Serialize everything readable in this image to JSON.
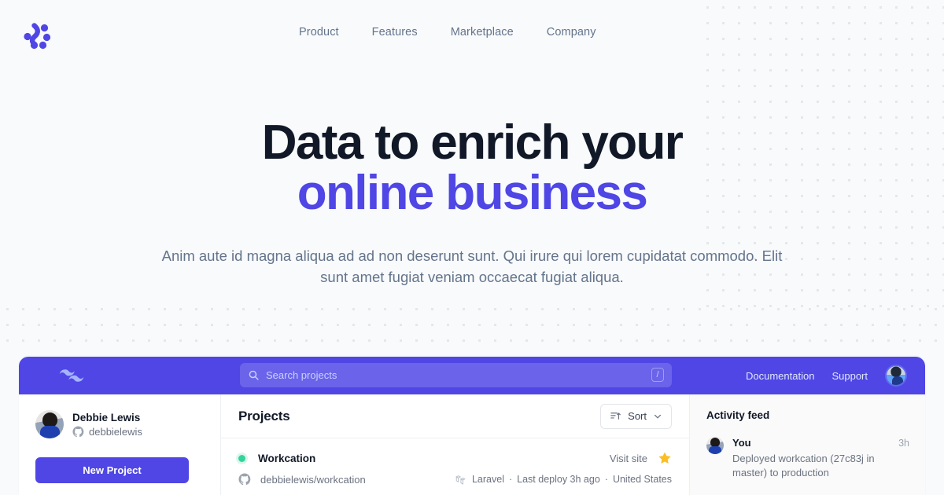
{
  "brand": {
    "logo_icon": "dots-cluster-logo",
    "accent_color": "#4f46e5",
    "page_bg": "#f8fafc"
  },
  "topnav": {
    "links": [
      {
        "label": "Product"
      },
      {
        "label": "Features"
      },
      {
        "label": "Marketplace"
      },
      {
        "label": "Company"
      }
    ]
  },
  "hero": {
    "headline_line1": "Data to enrich your",
    "headline_line2": "online business",
    "subtitle": "Anim aute id magna aliqua ad ad non deserunt sunt. Qui irure qui lorem cupidatat commodo. Elit sunt amet fugiat veniam occaecat fugiat aliqua."
  },
  "app": {
    "appbar": {
      "logo_icon": "tailwind-wave-logo",
      "search": {
        "icon": "search-icon",
        "placeholder": "Search projects",
        "value": "",
        "shortcut_key": "/"
      },
      "links": [
        {
          "label": "Documentation"
        },
        {
          "label": "Support"
        }
      ],
      "avatar_icon": "user-avatar"
    },
    "sidebar": {
      "user": {
        "name": "Debbie Lewis",
        "handle": "debbielewis",
        "handle_icon": "github-icon",
        "avatar_icon": "user-avatar"
      },
      "new_project_label": "New Project"
    },
    "projects": {
      "title": "Projects",
      "sort": {
        "label": "Sort",
        "icon": "sort-ascending-icon",
        "chevron": "chevron-down-icon"
      },
      "items": [
        {
          "status_color": "#34d399",
          "name": "Workcation",
          "visit_label": "Visit site",
          "starred": true,
          "star_color": "#fbbf24",
          "repo": "debbielewis/workcation",
          "repo_icon": "github-icon",
          "framework_icon": "laravel-icon",
          "framework": "Laravel",
          "separator": "·",
          "deploy": "Last deploy 3h ago",
          "region": "United States"
        }
      ]
    },
    "activity": {
      "title": "Activity feed",
      "items": [
        {
          "avatar_icon": "user-avatar",
          "who": "You",
          "when": "3h",
          "description": "Deployed workcation (27c83j in master) to production"
        }
      ]
    }
  }
}
